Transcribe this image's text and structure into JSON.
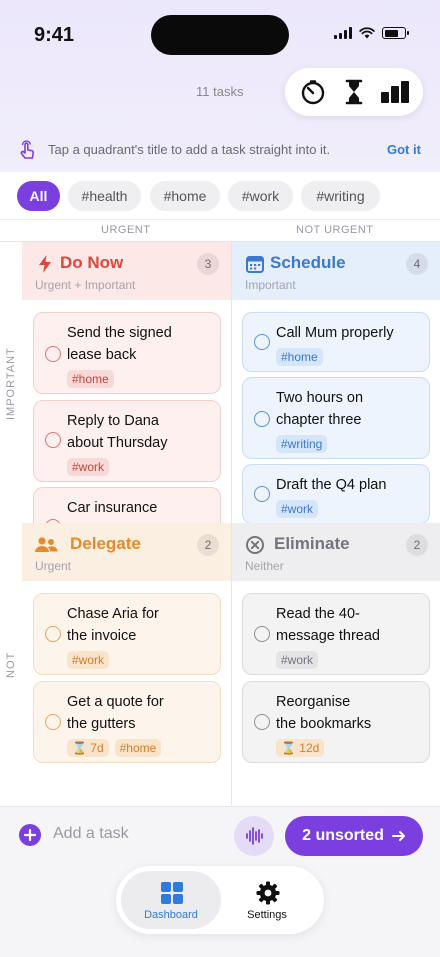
{
  "status": {
    "time": "9:41"
  },
  "header": {
    "task_count": "11 tasks"
  },
  "toolbar": {
    "icons": [
      "timer-icon",
      "hourglass-icon",
      "chart-icon"
    ]
  },
  "hint": {
    "text": "Tap a quadrant's title to add a task straight into it.",
    "action": "Got it"
  },
  "filters": [
    "All",
    "#health",
    "#home",
    "#work",
    "#writing"
  ],
  "axes": {
    "urgent": "URGENT",
    "not_urgent": "NOT URGENT",
    "important": "IMPORTANT",
    "not": "NOT"
  },
  "quadrants": {
    "do_now": {
      "title": "Do Now",
      "subtitle": "Urgent + Important",
      "count": "3",
      "color": "#e0473c",
      "tasks": [
        {
          "title_l1": "Send the signed",
          "title_l2": "lease back",
          "tags": [
            "#home"
          ]
        },
        {
          "title_l1": "Reply to Dana",
          "title_l2": "about Thursday",
          "tags": [
            "#work"
          ]
        },
        {
          "title_l1": "Car insurance",
          "title_l2": "",
          "tags": []
        }
      ]
    },
    "schedule": {
      "title": "Schedule",
      "subtitle": "Important",
      "count": "4",
      "color": "#3b78d0",
      "tasks": [
        {
          "title_l1": "Call Mum properly",
          "title_l2": "",
          "tags": [
            "#home"
          ]
        },
        {
          "title_l1": "Two hours on",
          "title_l2": "chapter three",
          "tags": [
            "#writing"
          ]
        },
        {
          "title_l1": "Draft the Q4 plan",
          "title_l2": "",
          "tags": [
            "#work"
          ]
        }
      ]
    },
    "delegate": {
      "title": "Delegate",
      "subtitle": "Urgent",
      "count": "2",
      "color": "#e58a2e",
      "tasks": [
        {
          "title_l1": "Chase Aria for",
          "title_l2": "the invoice",
          "tags": [
            "#work"
          ]
        },
        {
          "title_l1": "Get a quote for",
          "title_l2": "the gutters",
          "tags": [
            "⌛ 7d",
            "#home"
          ]
        }
      ]
    },
    "eliminate": {
      "title": "Eliminate",
      "subtitle": "Neither",
      "count": "2",
      "color": "#76737e",
      "tasks": [
        {
          "title_l1": "Read the 40-",
          "title_l2": "message thread",
          "tags": [
            "#work"
          ]
        },
        {
          "title_l1": "Reorganise",
          "title_l2": "the bookmarks",
          "tags": [
            "⌛ 12d"
          ]
        }
      ]
    }
  },
  "composer": {
    "placeholder": "Add a task",
    "unsorted": "2 unsorted",
    "accent": "#7b3fe0"
  },
  "tabs": [
    {
      "label": "Dashboard",
      "icon": "dashboard-icon",
      "active": true
    },
    {
      "label": "Settings",
      "icon": "gear-icon",
      "active": false
    }
  ]
}
